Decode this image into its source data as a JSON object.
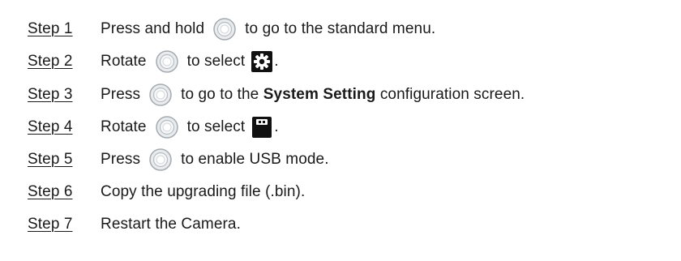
{
  "steps": [
    {
      "label": "Step 1",
      "parts": [
        "Press and hold",
        "to go to the standard menu."
      ]
    },
    {
      "label": "Step 2",
      "parts": [
        "Rotate",
        "to select",
        "."
      ]
    },
    {
      "label": "Step 3",
      "parts": [
        "Press",
        "to go to the",
        "System Setting",
        "configuration screen."
      ]
    },
    {
      "label": "Step 4",
      "parts": [
        "Rotate",
        "to select",
        "."
      ]
    },
    {
      "label": "Step 5",
      "parts": [
        "Press",
        "to enable USB mode."
      ]
    },
    {
      "label": "Step 6",
      "parts": [
        "Copy the upgrading file (.bin)."
      ]
    },
    {
      "label": "Step 7",
      "parts": [
        "Restart the Camera."
      ]
    }
  ],
  "icons": {
    "knob": "rotary-knob-icon",
    "settings": "settings-gear-icon",
    "usb": "usb-storage-icon"
  },
  "colors": {
    "text": "#1a1a1a",
    "icon_dark": "#111111",
    "knob_ring": "#9aa0a6"
  }
}
